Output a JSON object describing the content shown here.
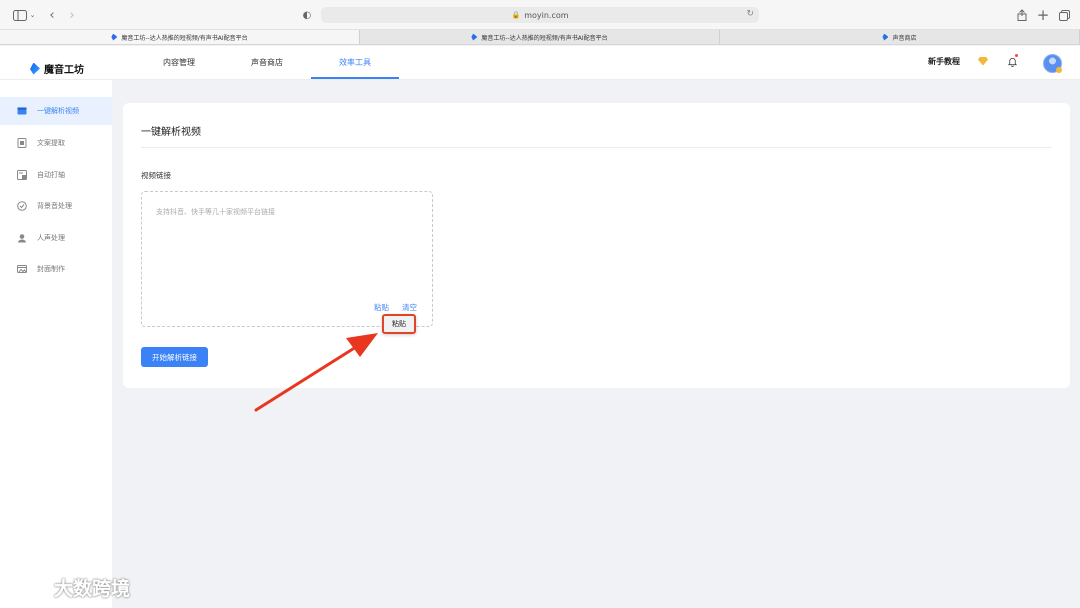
{
  "browser": {
    "url": "moyin.com",
    "tabs": [
      {
        "label": "魔音工坊--达人热推的短视频/有声书AI配音平台",
        "active": true
      },
      {
        "label": "魔音工坊--达人热推的短视频/有声书AI配音平台",
        "active": false
      },
      {
        "label": "声音商店",
        "active": false
      }
    ]
  },
  "header": {
    "logo_text": "魔音工坊",
    "nav": [
      {
        "label": "内容管理"
      },
      {
        "label": "声音商店"
      },
      {
        "label": "效率工具"
      }
    ],
    "tutorial_label": "新手教程"
  },
  "sidebar": {
    "items": [
      {
        "label": "一键解析视频"
      },
      {
        "label": "文案提取"
      },
      {
        "label": "自动打轴"
      },
      {
        "label": "背景音处理"
      },
      {
        "label": "人声处理"
      },
      {
        "label": "封面制作"
      }
    ]
  },
  "main": {
    "title": "一键解析视频",
    "field_label": "视频链接",
    "placeholder": "支持抖音、快手等几十家视频平台链接",
    "paste_label": "粘贴",
    "clear_label": "清空",
    "tooltip_label": "粘贴",
    "submit_label": "开始解析链接"
  },
  "watermark": {
    "text": "大数跨境"
  },
  "colors": {
    "accent": "#3a82f6",
    "highlight": "#e0452b"
  }
}
